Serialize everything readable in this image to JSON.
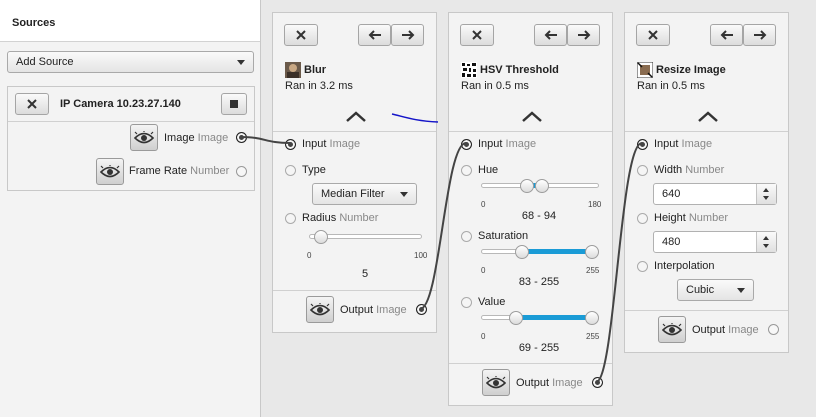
{
  "sources": {
    "header": "Sources",
    "add_source": "Add Source",
    "camera": {
      "title": "IP Camera 10.23.27.140",
      "outputs": [
        {
          "name": "Image",
          "type": "Image"
        },
        {
          "name": "Frame Rate",
          "type": "Number"
        }
      ]
    }
  },
  "blur": {
    "title": "Blur",
    "time": "Ran in 3.2 ms",
    "input": {
      "name": "Input",
      "type": "Image"
    },
    "type_label": "Type",
    "type_value": "Median Filter",
    "radius": {
      "name": "Radius",
      "type": "Number",
      "min": "0",
      "max": "100",
      "value": "5",
      "level": 0.05
    },
    "output": {
      "name": "Output",
      "type": "Image"
    }
  },
  "hsv": {
    "title": "HSV Threshold",
    "time": "Ran in 0.5 ms",
    "input": {
      "name": "Input",
      "type": "Image"
    },
    "hue": {
      "name": "Hue",
      "min": "0",
      "max": "180",
      "range": "68 - 94",
      "low": 68,
      "high": 94,
      "scale": 180
    },
    "saturation": {
      "name": "Saturation",
      "min": "0",
      "max": "255",
      "range": "83 - 255",
      "low": 83,
      "high": 255,
      "scale": 255
    },
    "value": {
      "name": "Value",
      "min": "0",
      "max": "255",
      "range": "69 - 255",
      "low": 69,
      "high": 255,
      "scale": 255
    },
    "output": {
      "name": "Output",
      "type": "Image"
    }
  },
  "resize": {
    "title": "Resize Image",
    "time": "Ran in 0.5 ms",
    "input": {
      "name": "Input",
      "type": "Image"
    },
    "width": {
      "name": "Width",
      "type": "Number",
      "value": "640"
    },
    "height": {
      "name": "Height",
      "type": "Number",
      "value": "480"
    },
    "interpolation_label": "Interpolation",
    "interpolation_value": "Cubic",
    "output": {
      "name": "Output",
      "type": "Image"
    }
  },
  "colors": {
    "accent": "#1a9bd6",
    "wire": "#444444",
    "stray_line": "#1414c8"
  }
}
